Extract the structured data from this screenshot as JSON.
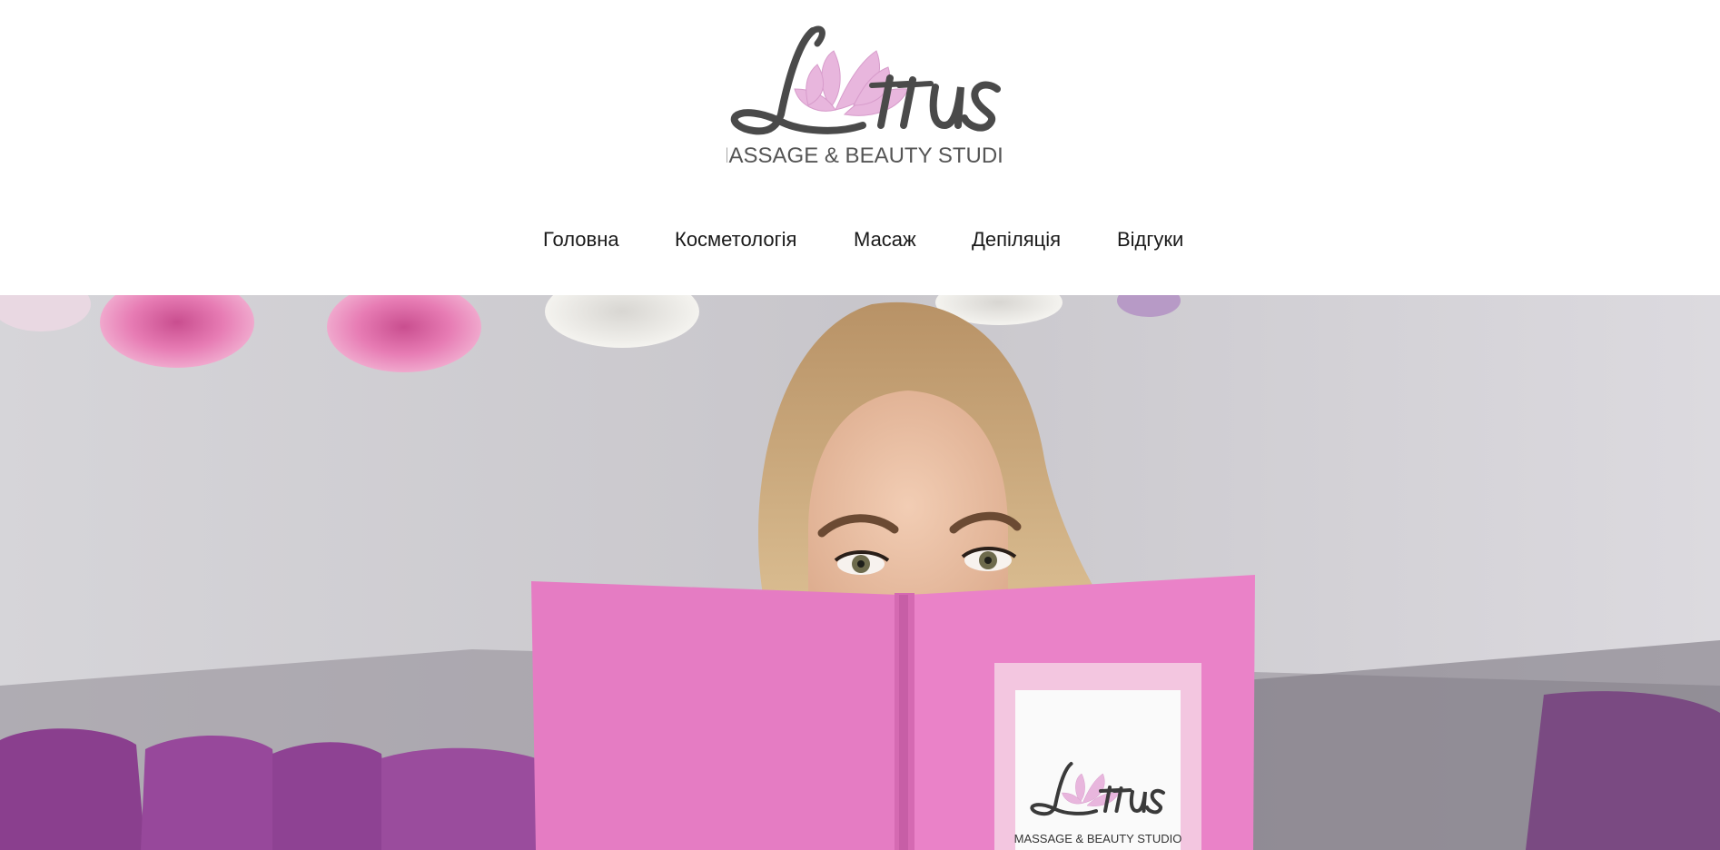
{
  "brand": {
    "logo_wordmark": "Lotus",
    "logo_tagline": "MASSAGE & BEAUTY STUDIO",
    "logo_text_color": "#4a4a4a",
    "logo_flower_color": "#e8b6dd"
  },
  "nav": {
    "items": [
      {
        "label": "Головна"
      },
      {
        "label": "Косметологія"
      },
      {
        "label": "Масаж"
      },
      {
        "label": "Депіляція"
      },
      {
        "label": "Відгуки"
      }
    ]
  },
  "hero": {
    "image_icon": "hero-photo",
    "book_cover_color": "#e77bc6",
    "wall_color": "#c9c7cc",
    "sofa_color": "#8a3f8e",
    "book_logo_wordmark": "Lotus",
    "book_logo_tagline": "MASSAGE & BEAUTY STUDIO"
  }
}
